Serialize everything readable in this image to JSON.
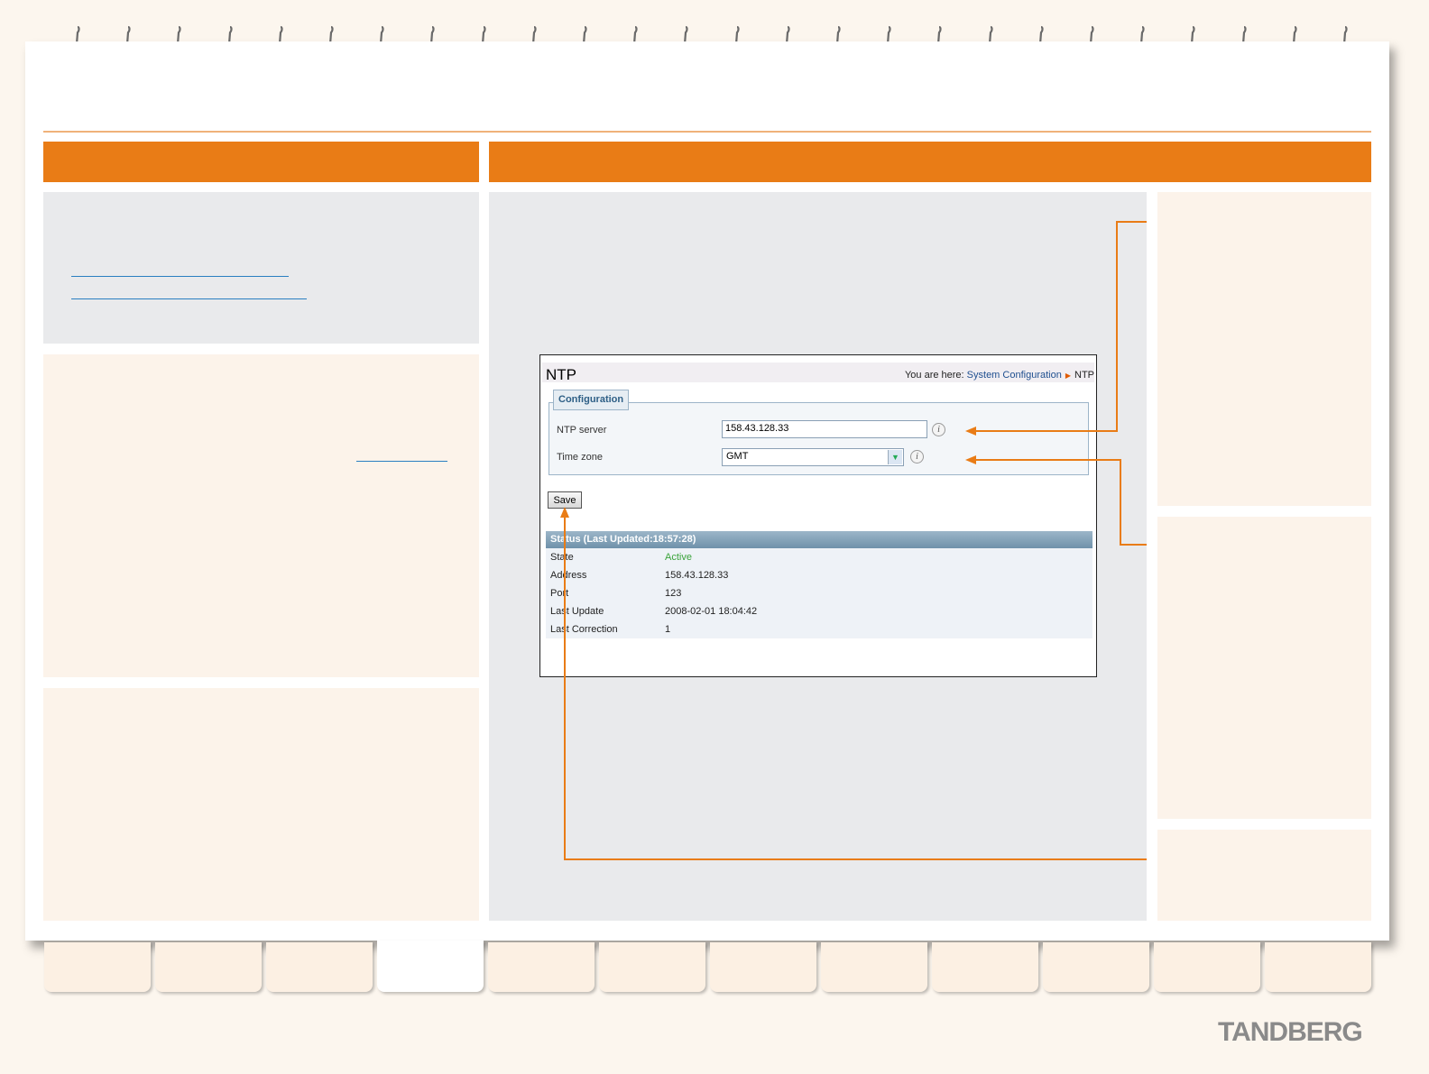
{
  "brand": {
    "logo": "TANDBERG"
  },
  "ntp_window": {
    "title": "NTP",
    "breadcrumb": {
      "prefix": "You are here:",
      "link": "System Configuration",
      "current": "NTP"
    },
    "config": {
      "legend": "Configuration",
      "ntp_server": {
        "label": "NTP server",
        "value": "158.43.128.33"
      },
      "time_zone": {
        "label": "Time zone",
        "value": "GMT"
      },
      "info_glyph": "i"
    },
    "save_label": "Save",
    "status": {
      "heading": "Status (Last Updated:18:57:28)",
      "rows": [
        {
          "label": "State",
          "value": "Active"
        },
        {
          "label": "Address",
          "value": "158.43.128.33"
        },
        {
          "label": "Port",
          "value": "123"
        },
        {
          "label": "Last Update",
          "value": "2008-02-01 18:04:42"
        },
        {
          "label": "Last Correction",
          "value": "1"
        }
      ]
    }
  },
  "colors": {
    "accent_orange": "#e97c16",
    "status_active": "#3aa33a"
  },
  "icons": [
    "ring-binding-icon",
    "info-icon",
    "chevron-down-icon"
  ]
}
